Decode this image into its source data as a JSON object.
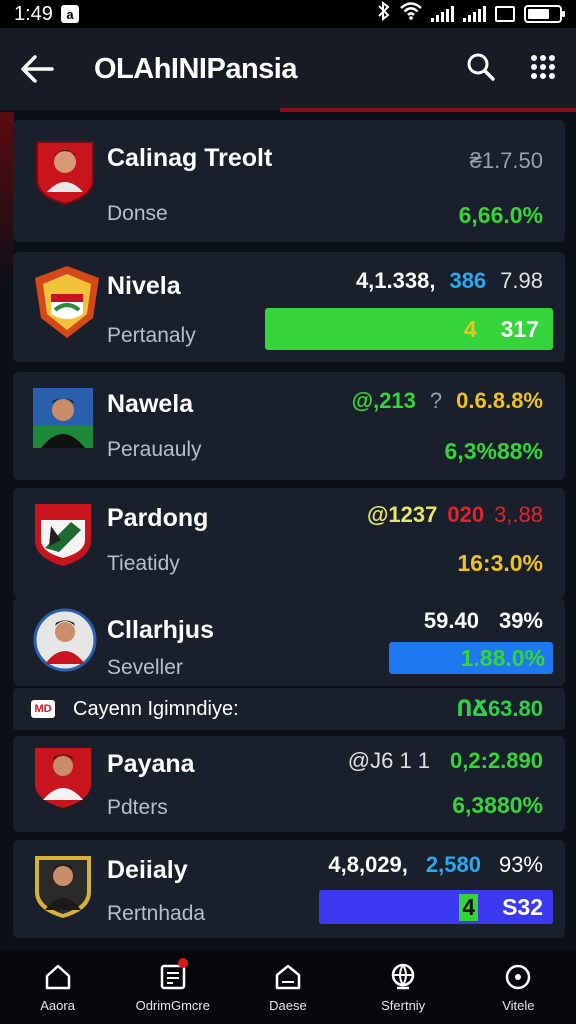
{
  "status": {
    "time": "1:49",
    "notif": "a"
  },
  "header": {
    "title": "OLAhINIPansia"
  },
  "rows": [
    {
      "name": "Calinag Treolt",
      "sub": "Donse",
      "top": [
        "₴1.7.50"
      ],
      "main": "6,66.0%"
    },
    {
      "name": "Nivela",
      "sub": "Pertanaly",
      "top": [
        "4,1.338,",
        "386",
        "7.98"
      ],
      "bar": [
        "4",
        "317"
      ]
    },
    {
      "name": "Nawela",
      "sub": "Perauauly",
      "top": [
        "@,213",
        "?",
        "0.6.8.8%"
      ],
      "main": "6,3%88%"
    },
    {
      "name": "Pardong",
      "sub": "Tieatidy",
      "top": [
        "@1237",
        "020",
        "3,.88"
      ],
      "main": "16:3.0%"
    },
    {
      "name": "Cllarhjus",
      "sub": "Seveller",
      "top": [
        "59.40",
        "39%"
      ],
      "bar": [
        "1.88.0%"
      ]
    },
    {
      "name": "Payana",
      "sub": "Pdters",
      "top": [
        "@J6 1 1",
        "0,2:2.890"
      ],
      "main": "6,3880%"
    },
    {
      "name": "Deiialy",
      "sub": "Rertnhada",
      "top": [
        "4,8,029,",
        "2,580",
        "93%"
      ],
      "bar": [
        "4",
        "S32"
      ]
    }
  ],
  "mini": {
    "badge": "MD",
    "label": "Cayenn Igimndiye:",
    "value": "ՈՃ63.80"
  },
  "nav": [
    {
      "label": "Aaora",
      "icon": "home-icon"
    },
    {
      "label": "OdrimGmcre",
      "icon": "inbox-icon"
    },
    {
      "label": "Daese",
      "icon": "house-icon"
    },
    {
      "label": "Sfertniy",
      "icon": "globe-icon"
    },
    {
      "label": "Vitele",
      "icon": "circle-dot-icon"
    }
  ],
  "colors": {
    "green": "#35d43a",
    "blue": "#1e78f0",
    "violet": "#3b3af0",
    "yellow": "#f0c21e",
    "red": "#e4232b"
  }
}
